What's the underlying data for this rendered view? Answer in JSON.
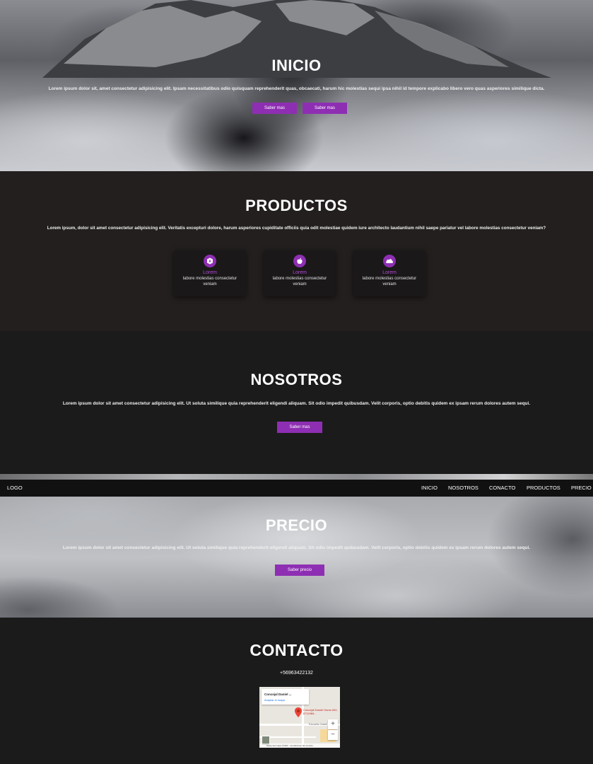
{
  "hero": {
    "title": "INICIO",
    "description": "Lorem ipsum dolor sit, amet consectetur adipisicing elit. Ipsam necessitatibus odio quisquam reprehenderit quas, obcaecati, harum hic molestias sequi ipsa nihil id tempore explicabo libero vero quas asperiores similique dicta.",
    "button1": "Saber mas",
    "button2": "Saber mas"
  },
  "productos": {
    "title": "PRODUCTOS",
    "description": "Lorem ipsum, dolor sit amet consectetur adipisicing elit. Veritatis excepturi dolore, harum asperiores cupiditate officiis quia odit molestiae quidem iure architecto laudantium nihil saepe pariatur vel labore molestias consectetur veniam?",
    "cards": [
      {
        "icon": "android-icon",
        "title": "Lorem",
        "text": "labore molestias consectetur veniam"
      },
      {
        "icon": "apple-icon",
        "title": "Lorem",
        "text": "labore molestias consectetur veniam"
      },
      {
        "icon": "cloud-icon",
        "title": "Lorem",
        "text": "labore molestias consectetur veniam"
      }
    ]
  },
  "nosotros": {
    "title": "NOSOTROS",
    "description": "Lorem ipsum dolor sit amet consectetur adipisicing elit. Ut soluta similique quia reprehenderit eligendi aliquam. Sit odio impedit quibusdam. Velit corporis, optio debitis quidem ex ipsam rerum dolores autem sequi.",
    "button": "Saber mas"
  },
  "navbar": {
    "logo": "LOGO",
    "items": [
      "INICIO",
      "NOSOTROS",
      "CONACTO",
      "PRODUCTOS",
      "PRECIO"
    ]
  },
  "precio": {
    "title": "PRECIO",
    "description": "Lorem ipsum dolor sit amet consectetur adipisicing elit. Ut soluta similique quia reprehenderit eligendi aliquam. Sit odio impedit quibusdam. Velit corporis, optio debitis quidem ex ipsam rerum dolores autem sequi.",
    "button": "Saber precio"
  },
  "contacto": {
    "title": "CONTACTO",
    "phone": "+56963422132",
    "map": {
      "place_name": "Concejal Daniel ...",
      "place_link": "Ampliar el mapa",
      "pin_label": "Concejal Daniel Gamo 841, 8711984...",
      "zoom_in": "+",
      "zoom_out": "−",
      "street_label": "Escuela Gaste",
      "footer": "Datos del mapa ©2023 · Condiciones del servicio"
    }
  },
  "colors": {
    "accent": "#8e2fb3",
    "dark_bg": "#1b1b1b",
    "productos_bg": "#231f1f"
  }
}
